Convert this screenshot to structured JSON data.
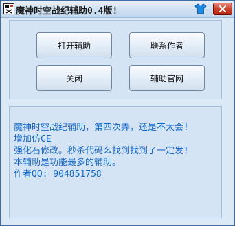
{
  "window": {
    "title": "魔神时空战纪辅助0.4版!",
    "icons": {
      "app": "app-icon",
      "skin": "tshirt-icon",
      "close": "close-icon"
    },
    "colors": {
      "accent_text": "#1569c7",
      "panel_bg": "#d4e4f5",
      "close_button": "#c8412a"
    }
  },
  "buttons": {
    "open_helper": "打开辅助",
    "contact_author": "联系作者",
    "close": "关闭",
    "official_site": "辅助官网"
  },
  "info": {
    "text": "魔神时空战纪辅助，第四次弄，还是不太会!\n增加仿CE\n强化石修改。秒杀代码么找到找到了一定发!\n本辅助是功能最多的辅助。\n作者QQ: 904851758"
  }
}
